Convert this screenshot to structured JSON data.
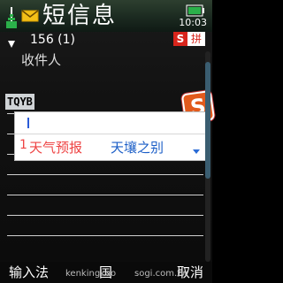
{
  "header": {
    "title": "短信息",
    "clock": "10:03",
    "icons": [
      "signal-icon",
      "envelope-icon",
      "battery-icon"
    ]
  },
  "info": {
    "count": "156 (1)",
    "ime_badge_s": "S",
    "ime_badge_pin": "拼"
  },
  "fields": {
    "recipient_label": "收件人"
  },
  "ime": {
    "composition": "TQYB",
    "input_text": "",
    "candidate_index": "1",
    "candidates": [
      "天气预报",
      "天壤之别"
    ],
    "logo_text": "S"
  },
  "softkeys": {
    "left": "输入法",
    "middle": "国",
    "right": "取消"
  },
  "watermark": {
    "left": "kenkingkuo",
    "right": "sogi.com.tw"
  },
  "colors": {
    "accent_red": "#e44",
    "accent_blue": "#1b5ec7",
    "header_green": "#1b2a20"
  }
}
